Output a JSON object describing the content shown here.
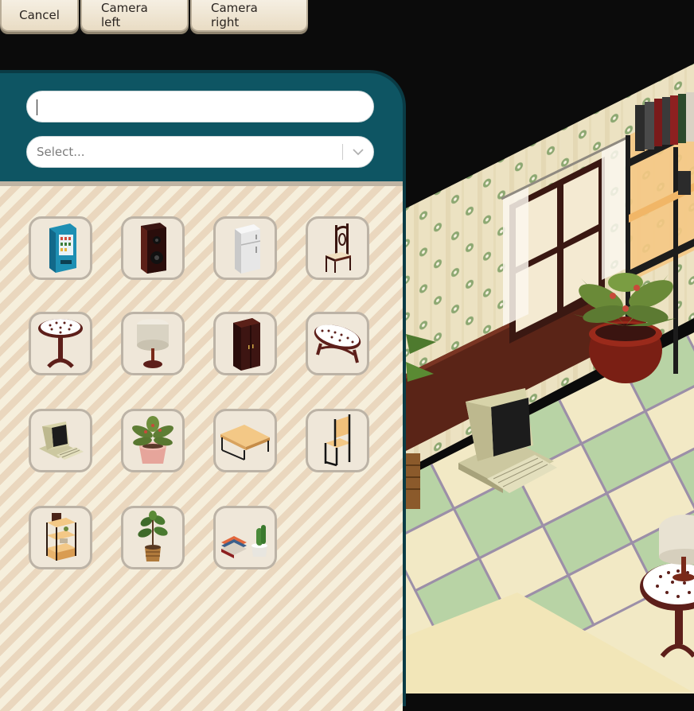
{
  "toolbar": {
    "cancel_label": "Cancel",
    "camera_left_label": "Camera left",
    "camera_right_label": "Camera right"
  },
  "catalog": {
    "search_value": "",
    "select_placeholder": "Select...",
    "items": [
      {
        "icon": "vending-machine-icon"
      },
      {
        "icon": "speaker-icon"
      },
      {
        "icon": "fridge-icon"
      },
      {
        "icon": "wooden-chair-icon"
      },
      {
        "icon": "round-side-table-icon"
      },
      {
        "icon": "table-lamp-icon"
      },
      {
        "icon": "wardrobe-icon"
      },
      {
        "icon": "oval-coffee-table-icon"
      },
      {
        "icon": "retro-computer-icon"
      },
      {
        "icon": "potted-plant-icon"
      },
      {
        "icon": "bench-table-icon"
      },
      {
        "icon": "modern-chair-icon"
      },
      {
        "icon": "shelf-unit-icon"
      },
      {
        "icon": "fiddle-leaf-plant-icon"
      },
      {
        "icon": "books-and-cactus-icon"
      }
    ]
  },
  "colors": {
    "panel": "#0e5563",
    "floor_light": "#f4ebc8",
    "floor_green": "#b7d3a5",
    "wall": "#ede3c4"
  }
}
